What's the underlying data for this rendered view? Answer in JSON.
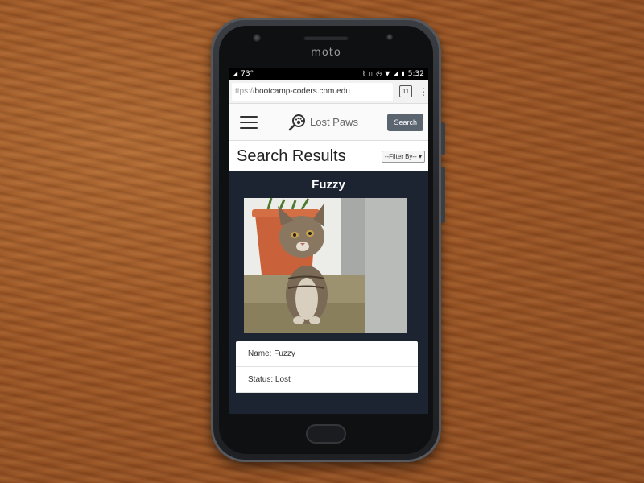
{
  "device": {
    "brand": "moto"
  },
  "statusbar": {
    "temp": "73°",
    "time": "5:32"
  },
  "browser": {
    "url_scheme": "ttps://",
    "url_host": "bootcamp-coders.cnm.edu",
    "tab_count": "11"
  },
  "navbar": {
    "logo_text": "Lost Paws",
    "search_label": "Search"
  },
  "page": {
    "title": "Search Results",
    "filter_label": "--Filter By--"
  },
  "result": {
    "pet_name": "Fuzzy",
    "name_line": "Name: Fuzzy",
    "status_line": "Status: Lost"
  },
  "colors": {
    "card_bg": "#1c2431",
    "search_btn": "#5a6570"
  }
}
